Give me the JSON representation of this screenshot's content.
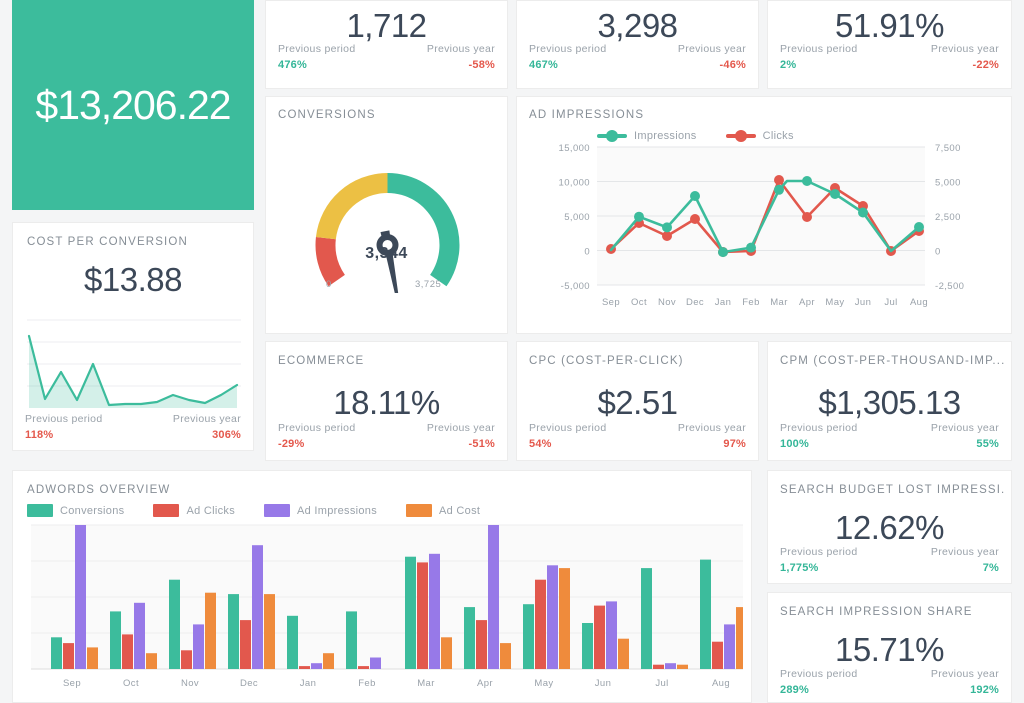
{
  "hero": {
    "value": "$13,206.22",
    "color": "#3cbc9c"
  },
  "kpis": {
    "clicks": {
      "value": "1,712",
      "prev_period_label": "Previous period",
      "prev_period": "476%",
      "prev_period_sign": "pos",
      "prev_year_label": "Previous year",
      "prev_year": "-58%",
      "prev_year_sign": "neg"
    },
    "impressions": {
      "value": "3,298",
      "prev_period_label": "Previous period",
      "prev_period": "467%",
      "prev_period_sign": "pos",
      "prev_year_label": "Previous year",
      "prev_year": "-46%",
      "prev_year_sign": "neg"
    },
    "ctr": {
      "value": "51.91%",
      "prev_period_label": "Previous period",
      "prev_period": "2%",
      "prev_period_sign": "pos",
      "prev_year_label": "Previous year",
      "prev_year": "-22%",
      "prev_year_sign": "neg"
    },
    "cost_per_conversion": {
      "title": "COST PER CONVERSION",
      "value": "$13.88",
      "prev_period_label": "Previous period",
      "prev_period": "118%",
      "prev_period_sign": "neg",
      "prev_year_label": "Previous year",
      "prev_year": "306%",
      "prev_year_sign": "neg"
    },
    "ecommerce": {
      "title": "ECOMMERCE",
      "value": "18.11%",
      "prev_period_label": "Previous period",
      "prev_period": "-29%",
      "prev_period_sign": "neg",
      "prev_year_label": "Previous year",
      "prev_year": "-51%",
      "prev_year_sign": "neg"
    },
    "cpc": {
      "title": "CPC (COST-PER-CLICK)",
      "value": "$2.51",
      "prev_period_label": "Previous period",
      "prev_period": "54%",
      "prev_period_sign": "neg",
      "prev_year_label": "Previous year",
      "prev_year": "97%",
      "prev_year_sign": "neg"
    },
    "cpm": {
      "title": "CPM (COST-PER-THOUSAND-IMP...",
      "value": "$1,305.13",
      "prev_period_label": "Previous period",
      "prev_period": "100%",
      "prev_period_sign": "pos",
      "prev_year_label": "Previous year",
      "prev_year": "55%",
      "prev_year_sign": "pos"
    },
    "search_budget_lost": {
      "title": "SEARCH BUDGET LOST IMPRESSI...",
      "value": "12.62%",
      "prev_period_label": "Previous period",
      "prev_period": "1,775%",
      "prev_period_sign": "pos",
      "prev_year_label": "Previous year",
      "prev_year": "7%",
      "prev_year_sign": "pos"
    },
    "search_impression_share": {
      "title": "SEARCH IMPRESSION SHARE",
      "value": "15.71%",
      "prev_period_label": "Previous period",
      "prev_period": "289%",
      "prev_period_sign": "pos",
      "prev_year_label": "Previous year",
      "prev_year": "192%",
      "prev_year_sign": "pos"
    }
  },
  "colors": {
    "teal": "#3cbc9c",
    "red": "#e2584d",
    "purple": "#9779e8",
    "orange": "#ef8b3c",
    "yellow": "#ecc044",
    "ink": "#3c4858",
    "muted": "#9aa2aa"
  },
  "chart_data": [
    {
      "type": "pie",
      "name": "conversions-gauge",
      "title": "CONVERSIONS",
      "value": 3344,
      "value_label": "3,344",
      "min": 0,
      "min_label": "0",
      "max": 3725,
      "max_label": "3,725",
      "bands": [
        {
          "label": "low",
          "color": "#e2584d",
          "from": 0,
          "to": 930
        },
        {
          "label": "mid",
          "color": "#ecc044",
          "from": 930,
          "to": 1862
        },
        {
          "label": "high",
          "color": "#3cbc9c",
          "from": 1862,
          "to": 3725
        }
      ]
    },
    {
      "type": "line",
      "name": "ad-impressions",
      "title": "AD IMPRESSIONS",
      "x": [
        "Sep",
        "Oct",
        "Nov",
        "Dec",
        "Jan",
        "Feb",
        "Mar",
        "Apr",
        "May",
        "Jun",
        "Jul",
        "Aug"
      ],
      "series": [
        {
          "name": "Impressions",
          "color": "#3cbc9c",
          "axis": "left",
          "values": [
            600,
            4900,
            3350,
            7900,
            350,
            1000,
            8800,
            10000,
            8200,
            5500,
            500,
            3400
          ]
        },
        {
          "name": "Clicks",
          "color": "#e2584d",
          "axis": "right",
          "values": [
            300,
            2150,
            1100,
            2550,
            200,
            250,
            6350,
            3000,
            5650,
            3950,
            250,
            1750
          ]
        }
      ],
      "ylabel": "",
      "xlabel": "",
      "ylim": [
        -5000,
        15000
      ],
      "yticks": [
        "-5,000",
        "0",
        "5,000",
        "10,000",
        "15,000"
      ],
      "y2lim": [
        -2500,
        7500
      ],
      "y2ticks": [
        "-2,500",
        "0",
        "2,500",
        "5,000",
        "7,500"
      ],
      "grid": true,
      "legend": "top"
    },
    {
      "type": "area",
      "name": "cost-per-conversion-sparkline",
      "color": "#3cbc9c",
      "values": [
        9.4,
        1.0,
        5.2,
        1.2,
        6.4,
        0.35,
        0.45,
        0.5,
        0.7,
        1.6,
        1.0,
        0.6,
        1.6,
        3.0
      ],
      "grid": true
    },
    {
      "type": "bar",
      "name": "adwords-overview",
      "title": "ADWORDS OVERVIEW",
      "categories": [
        "Sep",
        "Oct",
        "Nov",
        "Dec",
        "Jan",
        "Feb",
        "Mar",
        "Apr",
        "May",
        "Jun",
        "Jul",
        "Aug"
      ],
      "series": [
        {
          "name": "Conversions",
          "color": "#3cbc9c",
          "values": [
            22,
            40,
            62,
            52,
            37,
            40,
            78,
            43,
            45,
            32,
            70,
            76
          ]
        },
        {
          "name": "Ad Clicks",
          "color": "#e2584d",
          "values": [
            18,
            24,
            13,
            34,
            2,
            2,
            74,
            27,
            62,
            41,
            3,
            20
          ]
        },
        {
          "name": "Ad Impressions",
          "color": "#9779e8",
          "values": [
            100,
            46,
            31,
            86,
            4,
            8,
            80,
            100,
            72,
            47,
            4,
            30
          ]
        },
        {
          "name": "Ad Cost",
          "color": "#ef8b3c",
          "values": [
            15,
            11,
            53,
            52,
            11,
            0,
            22,
            16,
            70,
            21,
            3,
            38
          ]
        }
      ],
      "ylim": [
        0,
        100
      ],
      "grid": true,
      "legend": "top"
    }
  ]
}
